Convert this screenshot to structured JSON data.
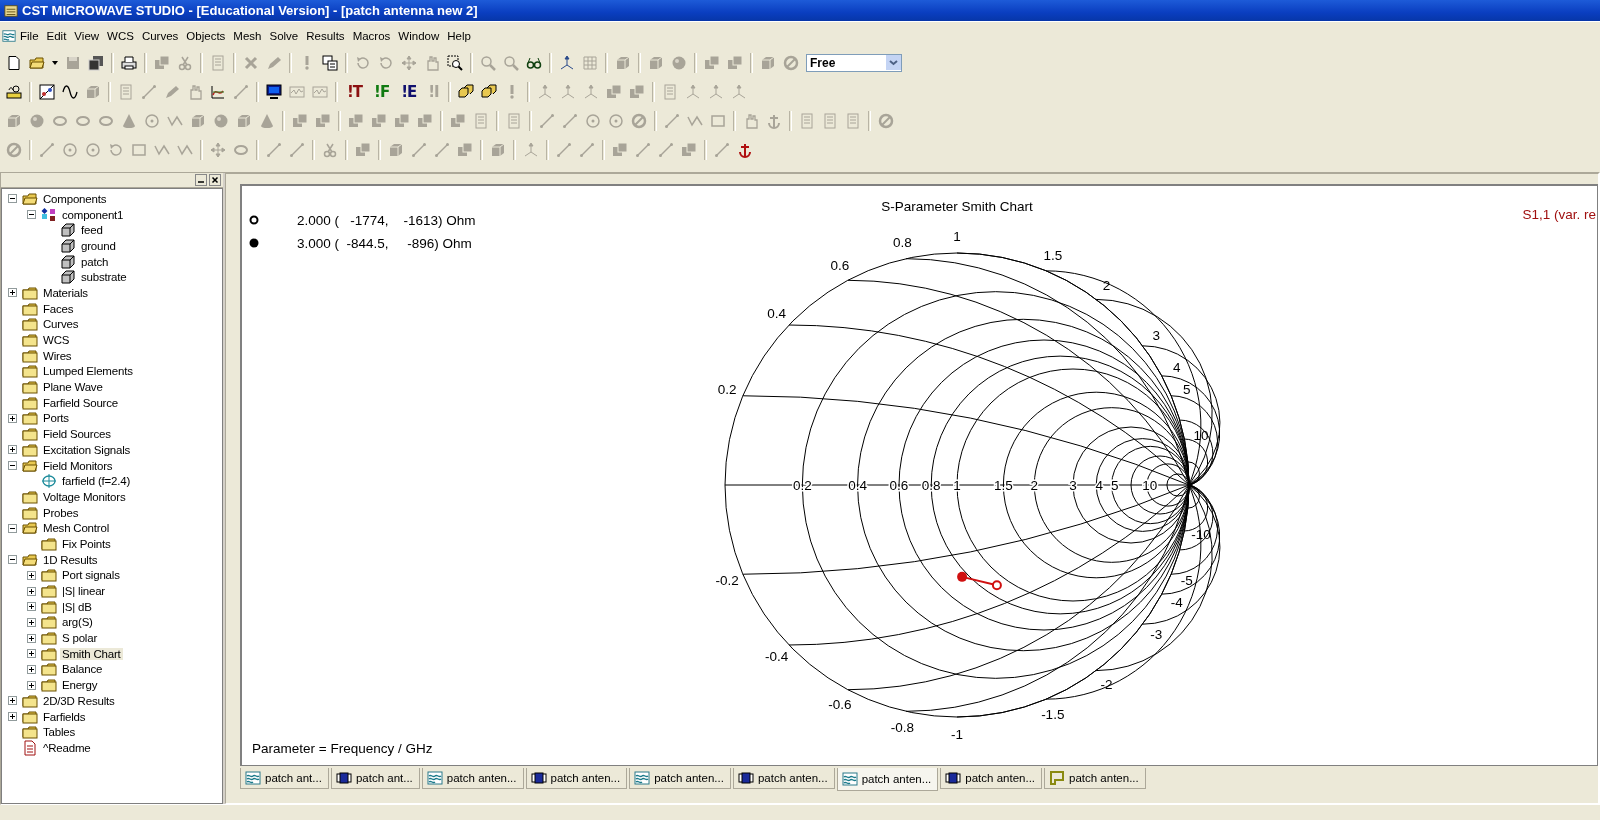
{
  "window": {
    "title": "CST MICROWAVE STUDIO - [Educational Version] - [patch antenna new 2]"
  },
  "menu": [
    "File",
    "Edit",
    "View",
    "WCS",
    "Curves",
    "Objects",
    "Mesh",
    "Solve",
    "Results",
    "Macros",
    "Window",
    "Help"
  ],
  "toolbar": {
    "solver_buttons": [
      {
        "label": "!T",
        "color": "#8b1010"
      },
      {
        "label": "!F",
        "color": "#107a10"
      },
      {
        "label": "!E",
        "color": "#10106e"
      },
      {
        "label": "!I",
        "color": "#a8a498"
      }
    ],
    "view_mode": {
      "value": "Free"
    }
  },
  "tree": [
    {
      "label": "Components",
      "kind": "folder",
      "expanded": true,
      "selected": false,
      "children": [
        {
          "label": "component1",
          "kind": "component",
          "expanded": true,
          "selected": false,
          "children": [
            {
              "label": "feed",
              "kind": "solid",
              "selected": false
            },
            {
              "label": "ground",
              "kind": "solid",
              "selected": false
            },
            {
              "label": "patch",
              "kind": "solid",
              "selected": false
            },
            {
              "label": "substrate",
              "kind": "solid",
              "selected": false
            }
          ]
        }
      ]
    },
    {
      "label": "Materials",
      "kind": "folder",
      "expanded": false,
      "selected": false
    },
    {
      "label": "Faces",
      "kind": "folder",
      "selected": false
    },
    {
      "label": "Curves",
      "kind": "folder",
      "selected": false
    },
    {
      "label": "WCS",
      "kind": "folder",
      "selected": false
    },
    {
      "label": "Wires",
      "kind": "folder",
      "selected": false
    },
    {
      "label": "Lumped Elements",
      "kind": "folder",
      "selected": false
    },
    {
      "label": "Plane Wave",
      "kind": "folder",
      "selected": false
    },
    {
      "label": "Farfield Source",
      "kind": "folder",
      "selected": false
    },
    {
      "label": "Ports",
      "kind": "folder",
      "expanded": false,
      "selected": false
    },
    {
      "label": "Field Sources",
      "kind": "folder",
      "selected": false
    },
    {
      "label": "Excitation Signals",
      "kind": "folder",
      "expanded": false,
      "selected": false
    },
    {
      "label": "Field Monitors",
      "kind": "folder",
      "expanded": true,
      "selected": false,
      "children": [
        {
          "label": "farfield (f=2.4)",
          "kind": "monitor",
          "selected": false
        }
      ]
    },
    {
      "label": "Voltage Monitors",
      "kind": "folder",
      "selected": false
    },
    {
      "label": "Probes",
      "kind": "folder",
      "selected": false
    },
    {
      "label": "Mesh Control",
      "kind": "folder",
      "expanded": true,
      "selected": false,
      "children": [
        {
          "label": "Fix Points",
          "kind": "folder",
          "selected": false
        }
      ]
    },
    {
      "label": "1D Results",
      "kind": "folder",
      "expanded": true,
      "selected": false,
      "children": [
        {
          "label": "Port signals",
          "kind": "folder",
          "expanded": false,
          "selected": false
        },
        {
          "label": "|S| linear",
          "kind": "folder",
          "expanded": false,
          "selected": false
        },
        {
          "label": "|S| dB",
          "kind": "folder",
          "expanded": false,
          "selected": false
        },
        {
          "label": "arg(S)",
          "kind": "folder",
          "expanded": false,
          "selected": false
        },
        {
          "label": "S polar",
          "kind": "folder",
          "expanded": false,
          "selected": false
        },
        {
          "label": "Smith Chart",
          "kind": "folder",
          "expanded": false,
          "selected": true
        },
        {
          "label": "Balance",
          "kind": "folder",
          "expanded": false,
          "selected": false
        },
        {
          "label": "Energy",
          "kind": "folder",
          "expanded": false,
          "selected": false
        }
      ]
    },
    {
      "label": "2D/3D Results",
      "kind": "folder",
      "expanded": false,
      "selected": false
    },
    {
      "label": "Farfields",
      "kind": "folder",
      "expanded": false,
      "selected": false
    },
    {
      "label": "Tables",
      "kind": "folder",
      "selected": false
    },
    {
      "label": "^Readme",
      "kind": "readme",
      "selected": false
    }
  ],
  "chart": {
    "title": "S-Parameter Smith Chart",
    "legend": [
      {
        "kind": "open",
        "text": "2.000 (   -1774,    -1613) Ohm"
      },
      {
        "kind": "filled",
        "text": "3.000 (  -844.5,     -896) Ohm"
      }
    ],
    "series_label": "S1,1 (var. re",
    "reactance_labels": [
      "0.2",
      "0.4",
      "0.6",
      "0.8",
      "1",
      "1.5",
      "2",
      "3",
      "4",
      "5",
      "10",
      "-0.2",
      "-0.4",
      "-0.6",
      "-0.8",
      "-1",
      "-1.5",
      "-2",
      "-3",
      "-4",
      "-5",
      "-10"
    ],
    "resistance_labels": [
      "0.2",
      "0.4",
      "0.6",
      "0.8",
      "1",
      "1.5",
      "2",
      "3",
      "4",
      "5",
      "10"
    ],
    "parameter_note": "Parameter = Frequency / GHz"
  },
  "tabs": [
    {
      "label": "patch ant...",
      "kind": "wave",
      "selected": false
    },
    {
      "label": "patch ant...",
      "kind": "block",
      "selected": false
    },
    {
      "label": "patch anten...",
      "kind": "wave",
      "selected": false
    },
    {
      "label": "patch anten...",
      "kind": "block",
      "selected": false
    },
    {
      "label": "patch anten...",
      "kind": "wave",
      "selected": false
    },
    {
      "label": "patch anten...",
      "kind": "block",
      "selected": false
    },
    {
      "label": "patch anten...",
      "kind": "wave",
      "selected": true
    },
    {
      "label": "patch anten...",
      "kind": "block",
      "selected": false
    },
    {
      "label": "patch anten...",
      "kind": "frame",
      "selected": false
    }
  ]
}
